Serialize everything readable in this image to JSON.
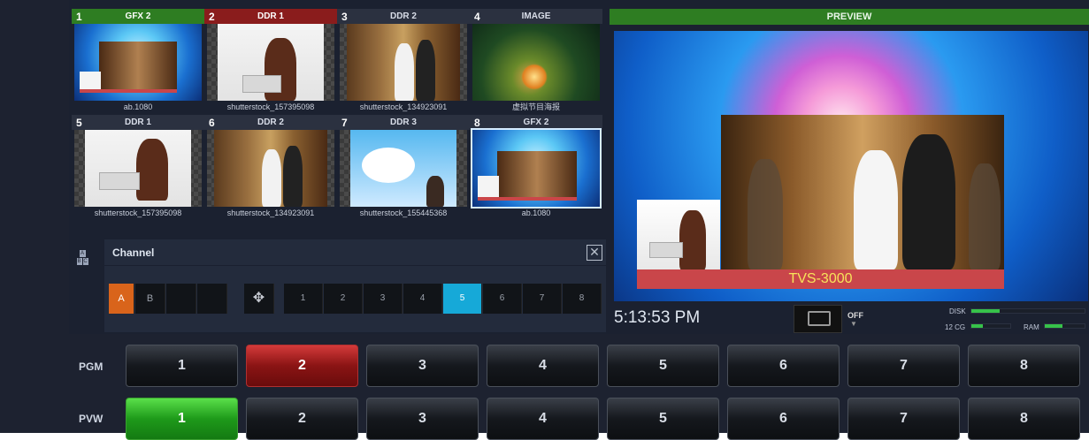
{
  "tiles": [
    {
      "num": "1",
      "name": "GFX 2",
      "caption": "ab.1080",
      "header": "green"
    },
    {
      "num": "2",
      "name": "DDR 1",
      "caption": "shutterstock_157395098",
      "header": "red"
    },
    {
      "num": "3",
      "name": "DDR 2",
      "caption": "shutterstock_134923091",
      "header": "normal"
    },
    {
      "num": "4",
      "name": "IMAGE",
      "caption": "虚拟节目海报",
      "header": "normal"
    },
    {
      "num": "5",
      "name": "DDR 1",
      "caption": "shutterstock_157395098",
      "header": "normal"
    },
    {
      "num": "6",
      "name": "DDR 2",
      "caption": "shutterstock_134923091",
      "header": "normal"
    },
    {
      "num": "7",
      "name": "DDR 3",
      "caption": "shutterstock_155445368",
      "header": "normal"
    },
    {
      "num": "8",
      "name": "GFX 2",
      "caption": "ab.1080",
      "header": "normal",
      "selected": true
    }
  ],
  "preview": {
    "label": "PREVIEW",
    "banner_text": "TVS-3000"
  },
  "status": {
    "clock": "5:13:53 PM",
    "off_label": "OFF",
    "disk_label": "DISK",
    "cg_label": "12 CG",
    "ram_label": "RAM",
    "disk_usage": 0.25,
    "cg_usage": 0.3,
    "ram_usage": 0.45
  },
  "channel": {
    "title": "Channel",
    "close_symbol": "✕",
    "buttons": [
      "A",
      "B",
      "",
      "",
      "✥",
      "1",
      "2",
      "3",
      "4",
      "5",
      "6",
      "7",
      "8"
    ],
    "active_layer": "A",
    "active_channel": "5"
  },
  "switcher": {
    "pgm_label": "PGM",
    "pvw_label": "PVW",
    "pgm_buttons": [
      "1",
      "2",
      "3",
      "4",
      "5",
      "6",
      "7",
      "8"
    ],
    "pvw_buttons": [
      "1",
      "2",
      "3",
      "4",
      "5",
      "6",
      "7",
      "8"
    ],
    "pgm_active": "2",
    "pvw_active": "1"
  },
  "colors": {
    "program_red": "#8a1414",
    "preview_green": "#1e9a1a",
    "channel_active": "#16a9d8",
    "layer_active": "#d9641b"
  }
}
